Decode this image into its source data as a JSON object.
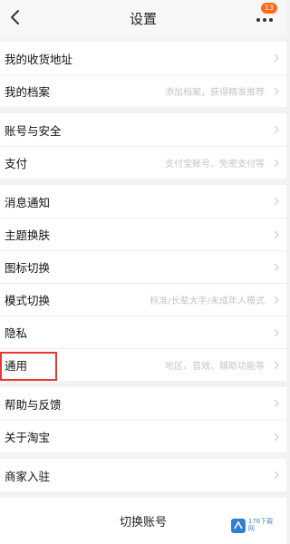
{
  "header": {
    "title": "设置",
    "badge": "13"
  },
  "groups": [
    {
      "items": [
        {
          "label": "我的收货地址",
          "sub": ""
        },
        {
          "label": "我的档案",
          "sub": "添加档案，获得精准推荐"
        }
      ]
    },
    {
      "items": [
        {
          "label": "账号与安全",
          "sub": ""
        },
        {
          "label": "支付",
          "sub": "支付宝账号、免密支付等"
        }
      ]
    },
    {
      "items": [
        {
          "label": "消息通知",
          "sub": ""
        },
        {
          "label": "主题换肤",
          "sub": ""
        },
        {
          "label": "图标切换",
          "sub": ""
        },
        {
          "label": "模式切换",
          "sub": "标准/长辈大字/未成年人模式"
        },
        {
          "label": "隐私",
          "sub": ""
        },
        {
          "label": "通用",
          "sub": "地区、音效、辅助功能等"
        }
      ]
    },
    {
      "items": [
        {
          "label": "帮助与反馈",
          "sub": ""
        },
        {
          "label": "关于淘宝",
          "sub": ""
        }
      ]
    },
    {
      "items": [
        {
          "label": "商家入驻",
          "sub": ""
        }
      ]
    }
  ],
  "bottom": {
    "label": "切换账号"
  },
  "watermark": {
    "text": "176下载网"
  },
  "colors": {
    "highlight": "#e53935",
    "badge": "#ff6a1a"
  }
}
